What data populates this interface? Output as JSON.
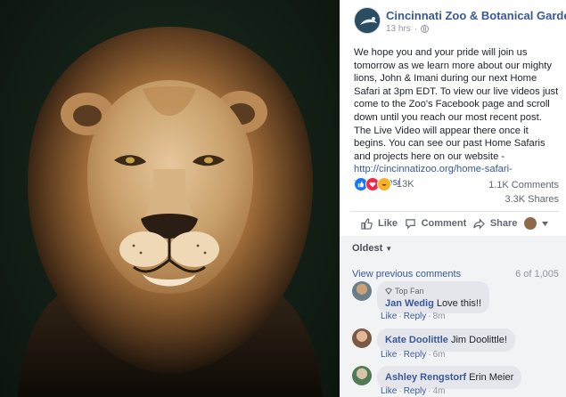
{
  "post": {
    "page_name": "Cincinnati Zoo & Botanical Garden",
    "time": "13 hrs",
    "dot": "·",
    "text": "We hope you and your pride will join us tomorrow as we learn more about our mighty lions, John & Imani during our next Home Safari at 3pm EDT. To view our live videos just come to the Zoo's Facebook page and scroll down until you reach our most recent post. The Live Video will appear there once it begins. You can see our past Home Safaris and projects here on our website -",
    "link": "http://cincinnatizoo.org/home-safari-resources/"
  },
  "stats": {
    "reactions": "13K",
    "comments": "1.1K Comments",
    "shares": "3.3K Shares"
  },
  "actions": {
    "like": "Like",
    "comment": "Comment",
    "share": "Share"
  },
  "comments": {
    "sort": "Oldest",
    "view_previous": "View previous comments",
    "count": "6 of 1,005",
    "items": [
      {
        "badge": "Top Fan",
        "author": "Jan Wedig",
        "text": "Love this!!",
        "like": "Like",
        "reply": "Reply",
        "time": "8m"
      },
      {
        "author": "Kate Doolittle",
        "text": "Jim Doolittle!",
        "like": "Like",
        "reply": "Reply",
        "time": "6m"
      },
      {
        "author": "Ashley Rengstorf",
        "text": "Erin Meier",
        "like": "Like",
        "reply": "Reply",
        "time": "4m"
      }
    ]
  },
  "colors": {
    "link": "#385898",
    "like_reaction": "#1877f2",
    "love_reaction": "#f0284a",
    "haha_reaction": "#f7b125"
  },
  "icons": [
    "globe-icon",
    "like-thumb-icon",
    "comment-bubble-icon",
    "share-arrow-icon",
    "chevron-down-icon",
    "top-fan-badge-icon"
  ]
}
